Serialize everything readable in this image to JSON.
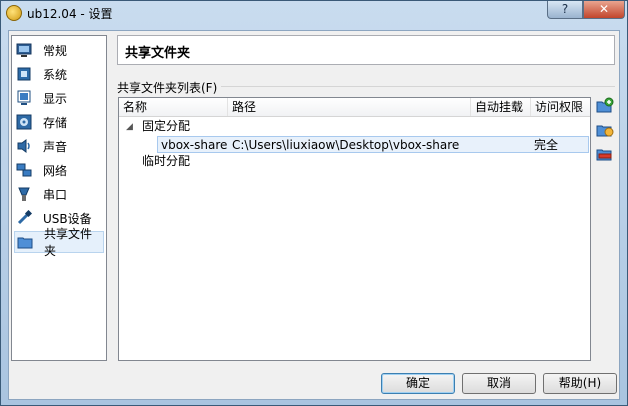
{
  "window": {
    "title": "ub12.04 - 设置",
    "help_label": "?",
    "close_label": "✕"
  },
  "sidebar": {
    "items": [
      {
        "label": "常规",
        "icon": "monitor-icon",
        "selected": false
      },
      {
        "label": "系统",
        "icon": "chip-icon",
        "selected": false
      },
      {
        "label": "显示",
        "icon": "display-icon",
        "selected": false
      },
      {
        "label": "存储",
        "icon": "disk-icon",
        "selected": false
      },
      {
        "label": "声音",
        "icon": "speaker-icon",
        "selected": false
      },
      {
        "label": "网络",
        "icon": "network-icon",
        "selected": false
      },
      {
        "label": "串口",
        "icon": "serial-icon",
        "selected": false
      },
      {
        "label": "USB设备",
        "icon": "usb-icon",
        "selected": false
      },
      {
        "label": "共享文件夹",
        "icon": "folder-icon",
        "selected": true
      }
    ]
  },
  "main": {
    "section_title": "共享文件夹",
    "list_group_label": "共享文件夹列表(F)",
    "columns": {
      "name": "名称",
      "path": "路径",
      "auto_mount": "自动挂载",
      "access": "访问权限"
    },
    "groups": [
      {
        "label": "固定分配",
        "expanded_glyph": "◢",
        "rows": [
          {
            "name": "vbox-share",
            "path": "C:\\Users\\liuxiaow\\Desktop\\vbox-share",
            "auto_mount": "",
            "access": "完全"
          }
        ]
      },
      {
        "label": "临时分配",
        "rows": []
      }
    ]
  },
  "buttons": {
    "ok": "确定",
    "cancel": "取消",
    "help": "帮助(H)"
  },
  "colors": {
    "selection": "#e8f1fb",
    "selection_border": "#a8c9ee",
    "title_bg": "#c9dcef",
    "close_red": "#c2452b"
  }
}
